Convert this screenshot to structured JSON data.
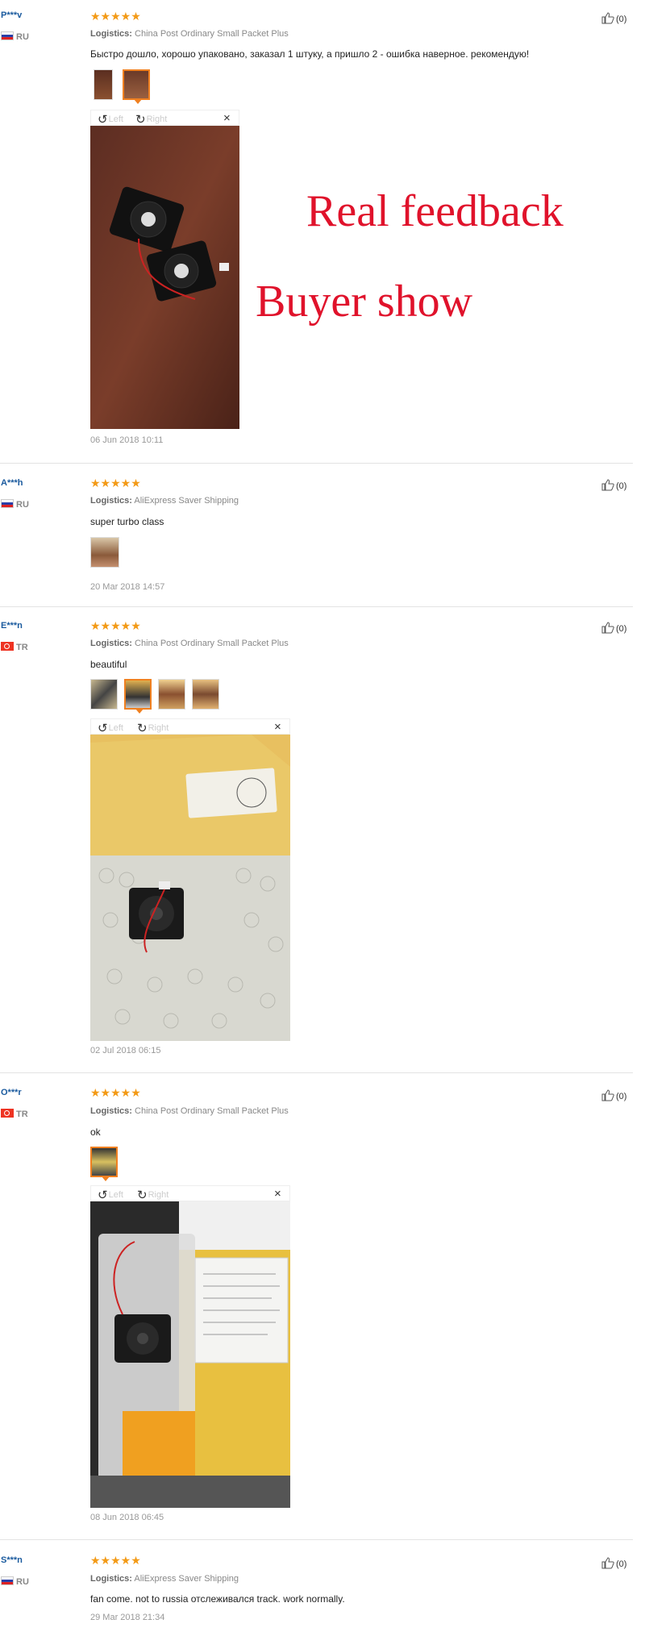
{
  "overlay": {
    "line1": "Real feedback",
    "line2": "Buyer show"
  },
  "reviews": [
    {
      "user": "P***v",
      "country": "RU",
      "stars": "★★★★★",
      "logistics_label": "Logistics:",
      "logistics": "China Post Ordinary Small Packet Plus",
      "text": "Быстро дошло, хорошо упаковано, заказал 1 штуку, а пришло 2 - ошибка наверное. рекомендую!",
      "date": "06 Jun 2018 10:11",
      "helpful": "(0)"
    },
    {
      "user": "A***h",
      "country": "RU",
      "stars": "★★★★★",
      "logistics_label": "Logistics:",
      "logistics": "AliExpress Saver Shipping",
      "text": "super turbo class",
      "date": "20 Mar 2018 14:57",
      "helpful": "(0)"
    },
    {
      "user": "E***n",
      "country": "TR",
      "stars": "★★★★★",
      "logistics_label": "Logistics:",
      "logistics": "China Post Ordinary Small Packet Plus",
      "text": "beautiful",
      "date": "02 Jul 2018 06:15",
      "helpful": "(0)"
    },
    {
      "user": "O***r",
      "country": "TR",
      "stars": "★★★★★",
      "logistics_label": "Logistics:",
      "logistics": "China Post Ordinary Small Packet Plus",
      "text": "ok",
      "date": "08 Jun 2018 06:45",
      "helpful": "(0)"
    },
    {
      "user": "S***n",
      "country": "RU",
      "stars": "★★★★★",
      "logistics_label": "Logistics:",
      "logistics": "AliExpress Saver Shipping",
      "text": "fan come. not to russia отслеживался track. work normally.",
      "date": "29 Mar 2018 21:34",
      "helpful": "(0)"
    }
  ],
  "viewer": {
    "left": "Left",
    "right": "Right",
    "close": "×"
  }
}
